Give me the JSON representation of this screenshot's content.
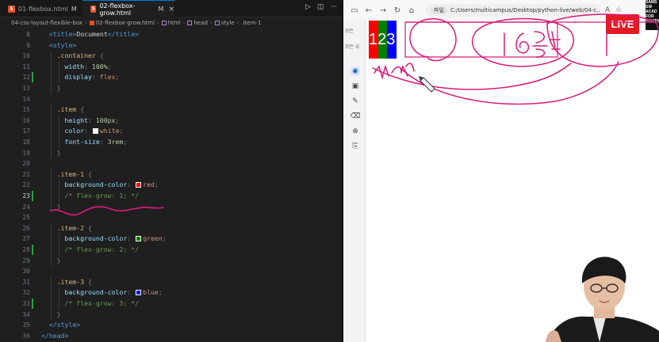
{
  "editor": {
    "tabs": [
      {
        "label": "01-flexbox.html",
        "modified": "M"
      },
      {
        "label": "02-flexbox-grow.html",
        "modified": "M",
        "active": true
      }
    ],
    "breadcrumb": [
      "04-css-layout-flexible-box",
      "02-flexbox-grow.html",
      "html",
      "head",
      "style",
      ".item-1"
    ],
    "code_lines": [
      {
        "n": "8",
        "html": "<span class='tag'>&lt;title&gt;</span><span class='txt'>Document</span><span class='tag'>&lt;/title&gt;</span>",
        "indent": 1
      },
      {
        "n": "9",
        "html": "<span class='tag'>&lt;style&gt;</span>",
        "indent": 1
      },
      {
        "n": "10",
        "html": "<span class='sel'>.container</span> <span class='pun'>{</span>",
        "indent": 2
      },
      {
        "n": "11",
        "html": "<span class='prop'>width</span><span class='pun'>:</span> <span class='num'>100%</span><span class='pun'>;</span>",
        "indent": 3
      },
      {
        "n": "12",
        "html": "<span class='prop'>display</span><span class='pun'>:</span> <span class='val'>flex</span><span class='pun'>;</span>",
        "indent": 3
      },
      {
        "n": "13",
        "html": "<span class='pun'>}</span>",
        "indent": 2
      },
      {
        "n": "14",
        "html": "",
        "indent": 0
      },
      {
        "n": "15",
        "html": "<span class='sel'>.item</span> <span class='pun'>{</span>",
        "indent": 2
      },
      {
        "n": "16",
        "html": "<span class='prop'>height</span><span class='pun'>:</span> <span class='num'>100px</span><span class='pun'>;</span>",
        "indent": 3
      },
      {
        "n": "17",
        "html": "<span class='prop'>color</span><span class='pun'>:</span> <span class='sw' style='background:#ffffff'></span><span class='val'>white</span><span class='pun'>;</span>",
        "indent": 3
      },
      {
        "n": "18",
        "html": "<span class='prop'>font-size</span><span class='pun'>:</span> <span class='num'>3rem</span><span class='pun'>;</span>",
        "indent": 3
      },
      {
        "n": "19",
        "html": "<span class='pun'>}</span>",
        "indent": 2
      },
      {
        "n": "20",
        "html": "",
        "indent": 0
      },
      {
        "n": "21",
        "html": "<span class='sel'>.item-1</span> <span class='pun'>{</span>",
        "indent": 2
      },
      {
        "n": "22",
        "html": "<span class='prop'>background-color</span><span class='pun'>:</span> <span class='sw' style='background:#ff0000'></span><span class='val'>red</span><span class='pun'>;</span>",
        "indent": 3
      },
      {
        "n": "23",
        "html": "<span class='cmt'>/* flex-grow: 1; */</span>",
        "indent": 3
      },
      {
        "n": "24",
        "html": "<span class='pun'>}</span>",
        "indent": 2
      },
      {
        "n": "25",
        "html": "",
        "indent": 0
      },
      {
        "n": "26",
        "html": "<span class='sel'>.item-2</span> <span class='pun'>{</span>",
        "indent": 2
      },
      {
        "n": "27",
        "html": "<span class='prop'>background-color</span><span class='pun'>:</span> <span class='sw' style='background:#008000'></span><span class='val'>green</span><span class='pun'>;</span>",
        "indent": 3
      },
      {
        "n": "28",
        "html": "<span class='cmt'>/* flex-grow: 2; */</span>",
        "indent": 3
      },
      {
        "n": "29",
        "html": "<span class='pun'>}</span>",
        "indent": 2
      },
      {
        "n": "30",
        "html": "",
        "indent": 0
      },
      {
        "n": "31",
        "html": "<span class='sel'>.item-3</span> <span class='pun'>{</span>",
        "indent": 2
      },
      {
        "n": "32",
        "html": "<span class='prop'>background-color</span><span class='pun'>:</span> <span class='sw' style='background:#0000ff'></span><span class='val'>blue</span><span class='pun'>;</span>",
        "indent": 3
      },
      {
        "n": "33",
        "html": "<span class='cmt'>/* flex-grow: 3; */</span>",
        "indent": 3
      },
      {
        "n": "34",
        "html": "<span class='pun'>}</span>",
        "indent": 2
      },
      {
        "n": "35",
        "html": "<span class='tag'>&lt;/style&gt;</span>",
        "indent": 1
      },
      {
        "n": "36",
        "html": "<span class='tag'>&lt;/head&gt;</span>",
        "indent": 0
      }
    ],
    "active_line": "23",
    "modified_lines": [
      "12",
      "23",
      "28",
      "33"
    ]
  },
  "browser": {
    "address_chip": "파일",
    "url": "C:/Users/multicampus/Desktop/python-live/web/04-c...",
    "side_labels": [
      "모든",
      "모든 요"
    ],
    "page_digits": "123"
  },
  "overlay": {
    "live_label": "LIVE",
    "brand_lines": [
      "SAMS",
      "SW",
      "ACAD",
      "FOR",
      "YOUTH"
    ],
    "handwriting": "16등분"
  },
  "colors": {
    "red": "#ff0000",
    "green": "#008000",
    "blue": "#0000ff",
    "ink": "#d81b7a",
    "live": "#e51b24"
  }
}
